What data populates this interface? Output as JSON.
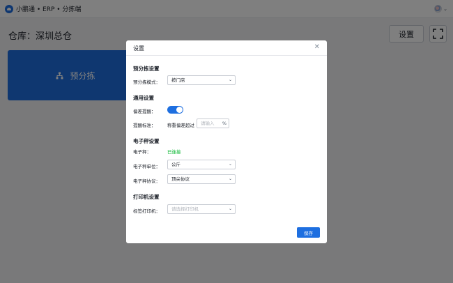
{
  "app": {
    "title": "小鹏通 • ERP • 分拣端"
  },
  "page": {
    "warehouse": "仓库：深圳总仓",
    "settings_button": "设置"
  },
  "card": {
    "presort_label": "预分拣"
  },
  "modal": {
    "title": "设置",
    "presort": {
      "title": "预分拣设置",
      "mode_label": "预分拣模式：",
      "mode_value": "按门店"
    },
    "general": {
      "title": "通用设置",
      "deviation_alert_label": "偏差提醒：",
      "deviation_alert_on": true,
      "alert_standard_label": "提醒标准：",
      "alert_standard_text": "称重偏差超过",
      "alert_input_placeholder": "请输入",
      "alert_unit": "%"
    },
    "scale": {
      "title": "电子秤设置",
      "scale_label": "电子秤：",
      "scale_status": "已连接",
      "unit_label": "电子秤单位：",
      "unit_value": "公斤",
      "protocol_label": "电子秤协议：",
      "protocol_value": "顶尖协议"
    },
    "printer": {
      "title": "打印机设置",
      "label_printer_label": "标签打印机：",
      "label_printer_placeholder": "请选择打印机"
    },
    "save_button": "保存"
  },
  "colors": {
    "primary": "#1e6fe0",
    "success": "#00b42a"
  },
  "icons": [
    "logo-icon",
    "avatar",
    "chevron-down-icon",
    "fullscreen-icon",
    "sitemap-icon",
    "close-icon",
    "caret-down-icon"
  ]
}
